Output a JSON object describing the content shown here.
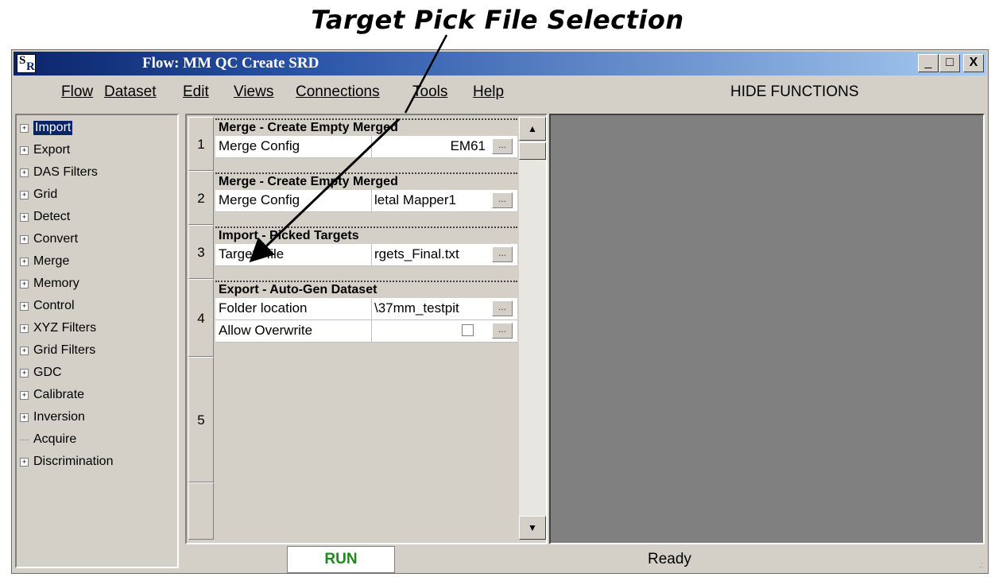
{
  "annotation": "Target Pick File Selection",
  "window": {
    "icon_s": "S",
    "icon_r": "R",
    "title": "Flow: MM QC Create SRD",
    "btn_minimize": "_",
    "btn_maximize": "□",
    "btn_close": "X"
  },
  "menu": {
    "items": [
      {
        "label": "Flow"
      },
      {
        "label": "Dataset"
      },
      {
        "label": "Edit"
      },
      {
        "label": "Views"
      },
      {
        "label": "Connections"
      },
      {
        "label": "Tools"
      },
      {
        "label": "Help"
      }
    ],
    "hide_functions": "HIDE FUNCTIONS"
  },
  "tree": {
    "items": [
      {
        "label": "Import",
        "expandable": true,
        "selected": true
      },
      {
        "label": "Export",
        "expandable": true
      },
      {
        "label": "DAS Filters",
        "expandable": true
      },
      {
        "label": "Grid",
        "expandable": true
      },
      {
        "label": "Detect",
        "expandable": true
      },
      {
        "label": "Convert",
        "expandable": true
      },
      {
        "label": "Merge",
        "expandable": true
      },
      {
        "label": "Memory",
        "expandable": true
      },
      {
        "label": "Control",
        "expandable": true
      },
      {
        "label": "XYZ Filters",
        "expandable": true
      },
      {
        "label": "Grid Filters",
        "expandable": true
      },
      {
        "label": "GDC",
        "expandable": true
      },
      {
        "label": "Calibrate",
        "expandable": true
      },
      {
        "label": "Inversion",
        "expandable": true
      },
      {
        "label": "Acquire",
        "expandable": false
      },
      {
        "label": "Discrimination",
        "expandable": true
      }
    ]
  },
  "flow": {
    "steps": [
      "1",
      "2",
      "3",
      "4",
      "5"
    ],
    "modules": [
      {
        "title": "Merge - Create Empty Merged",
        "rows": [
          {
            "label": "Merge Config",
            "value": "EM61"
          }
        ]
      },
      {
        "title": "Merge - Create Empty Merged",
        "rows": [
          {
            "label": "Merge Config",
            "value": "letal Mapper1"
          }
        ]
      },
      {
        "title": "Import - Picked Targets",
        "rows": [
          {
            "label": "Targets file",
            "value": "rgets_Final.txt"
          }
        ]
      },
      {
        "title": "Export - Auto-Gen Dataset",
        "rows": [
          {
            "label": "Folder location",
            "value": "\\37mm_testpit"
          },
          {
            "label": "Allow Overwrite",
            "value": ""
          }
        ]
      }
    ],
    "browse_label": "...",
    "scroll_up": "▲",
    "scroll_down": "▼"
  },
  "footer": {
    "run_label": "RUN",
    "status": "Ready",
    "grip": ".:"
  },
  "colors": {
    "title_start": "#0a246a",
    "title_end": "#a6caf0",
    "run_text": "#1c8a1c",
    "display_bg": "#808080"
  }
}
